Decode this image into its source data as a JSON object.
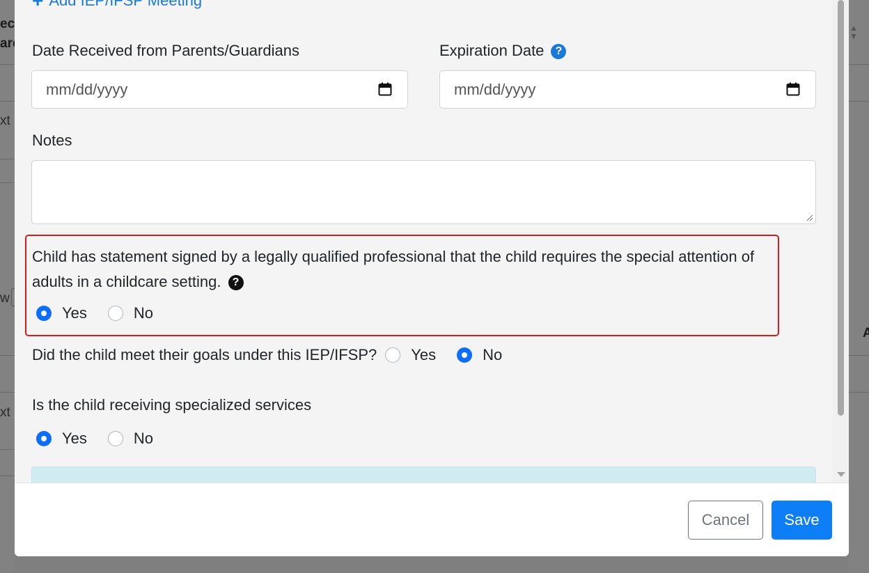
{
  "background": {
    "left_fragments": [
      "ece",
      "are",
      "xt",
      "w",
      "xt"
    ],
    "right_fragment": "A"
  },
  "form": {
    "add_meeting_link": "Add IEP/IFSP Meeting",
    "date_received_label": "Date Received from Parents/Guardians",
    "date_received_placeholder": "mm/dd/yyyy",
    "expiration_label": "Expiration Date",
    "expiration_placeholder": "mm/dd/yyyy",
    "notes_label": "Notes",
    "notes_value": "",
    "statement_question": "Child has statement signed by a legally qualified professional that the child requires the special attention of adults in a childcare setting.",
    "statement_yes": "Yes",
    "statement_no": "No",
    "statement_selected": "Yes",
    "goals_question": "Did the child meet their goals under this IEP/IFSP?",
    "goals_yes": "Yes",
    "goals_no": "No",
    "goals_selected": "No",
    "services_question": "Is the child receiving specialized services",
    "services_yes": "Yes",
    "services_no": "No",
    "services_selected": "Yes"
  },
  "footer": {
    "cancel_label": "Cancel",
    "save_label": "Save"
  },
  "colors": {
    "primary": "#0d6efd",
    "link": "#1a7ad9",
    "highlight_border": "#d61b1b",
    "info_bg": "#d1ecf1"
  }
}
